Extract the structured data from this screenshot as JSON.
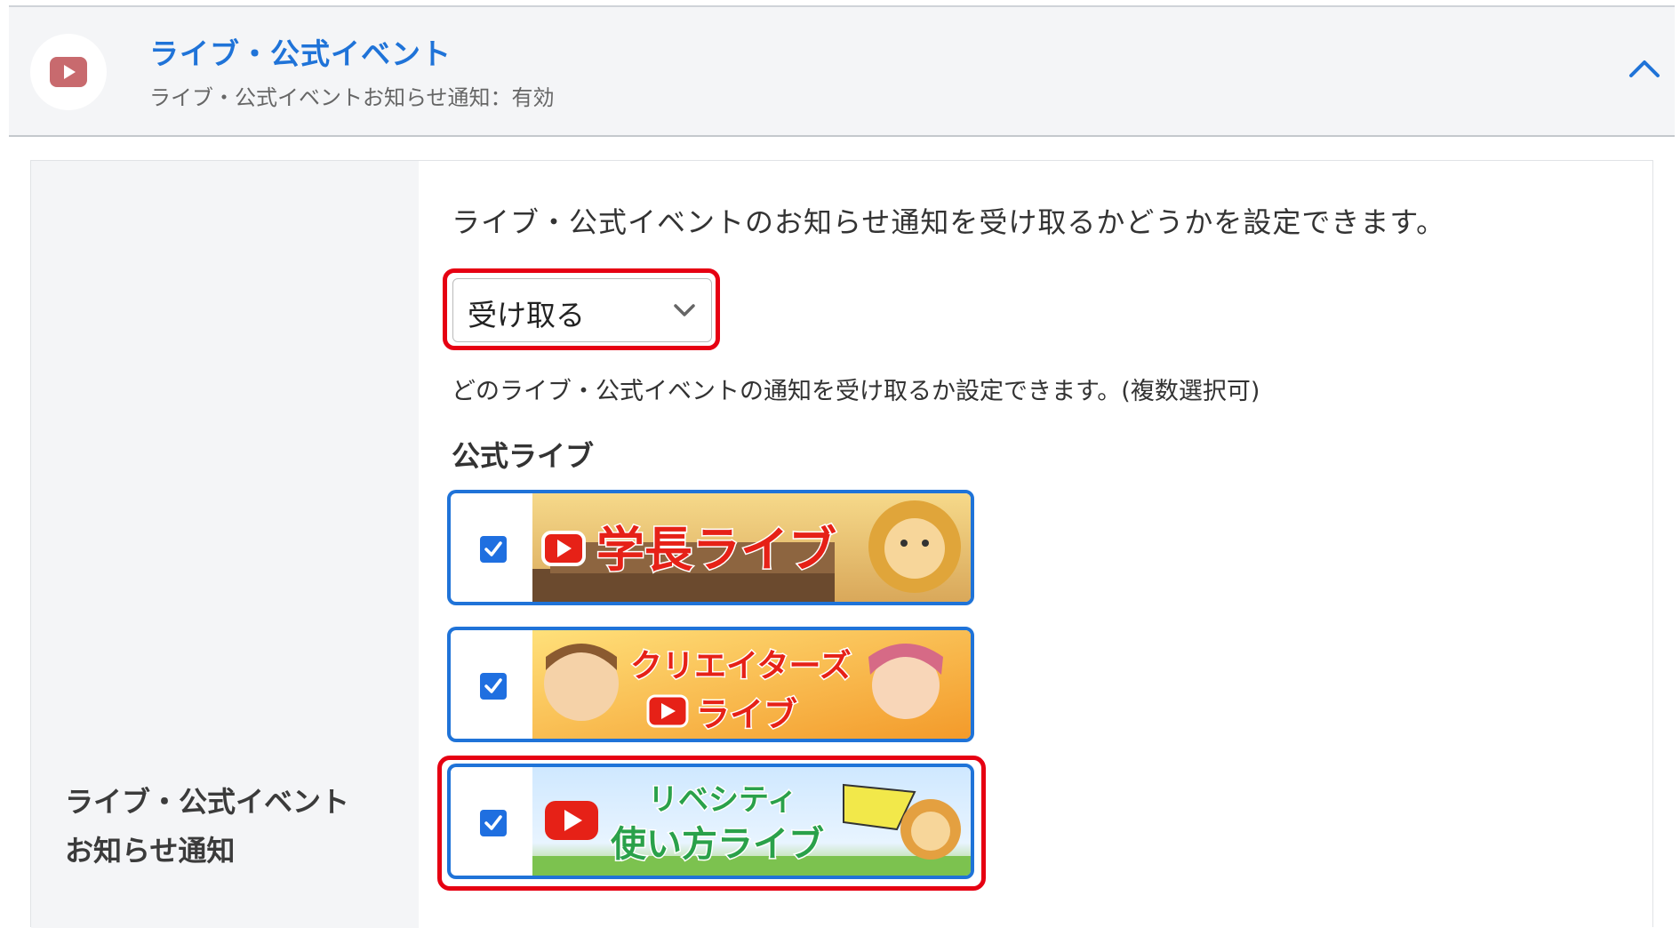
{
  "header": {
    "title": "ライブ・公式イベント",
    "subtitle": "ライブ・公式イベントお知らせ通知：有効",
    "icon": "youtube-play-icon",
    "collapse_icon": "chevron-up-icon"
  },
  "setting": {
    "label_line1": "ライブ・公式イベント",
    "label_line2": "お知らせ通知",
    "description": "ライブ・公式イベントのお知らせ通知を受け取るかどうかを設定できます。",
    "select_value": "受け取る",
    "selection_description": "どのライブ・公式イベントの通知を受け取るか設定できます。(複数選択可)",
    "section_title": "公式ライブ"
  },
  "events": [
    {
      "banner_text": "学長ライブ",
      "checked": true
    },
    {
      "banner_text_line1": "クリエイターズ",
      "banner_text_line2": "ライブ",
      "checked": true
    },
    {
      "banner_text_line1": "リベシティ",
      "banner_text_line2": "使い方ライブ",
      "checked": true
    }
  ],
  "colors": {
    "accent_blue": "#1f73d8",
    "highlight_red": "#e60012",
    "youtube_red": "#e62117"
  }
}
